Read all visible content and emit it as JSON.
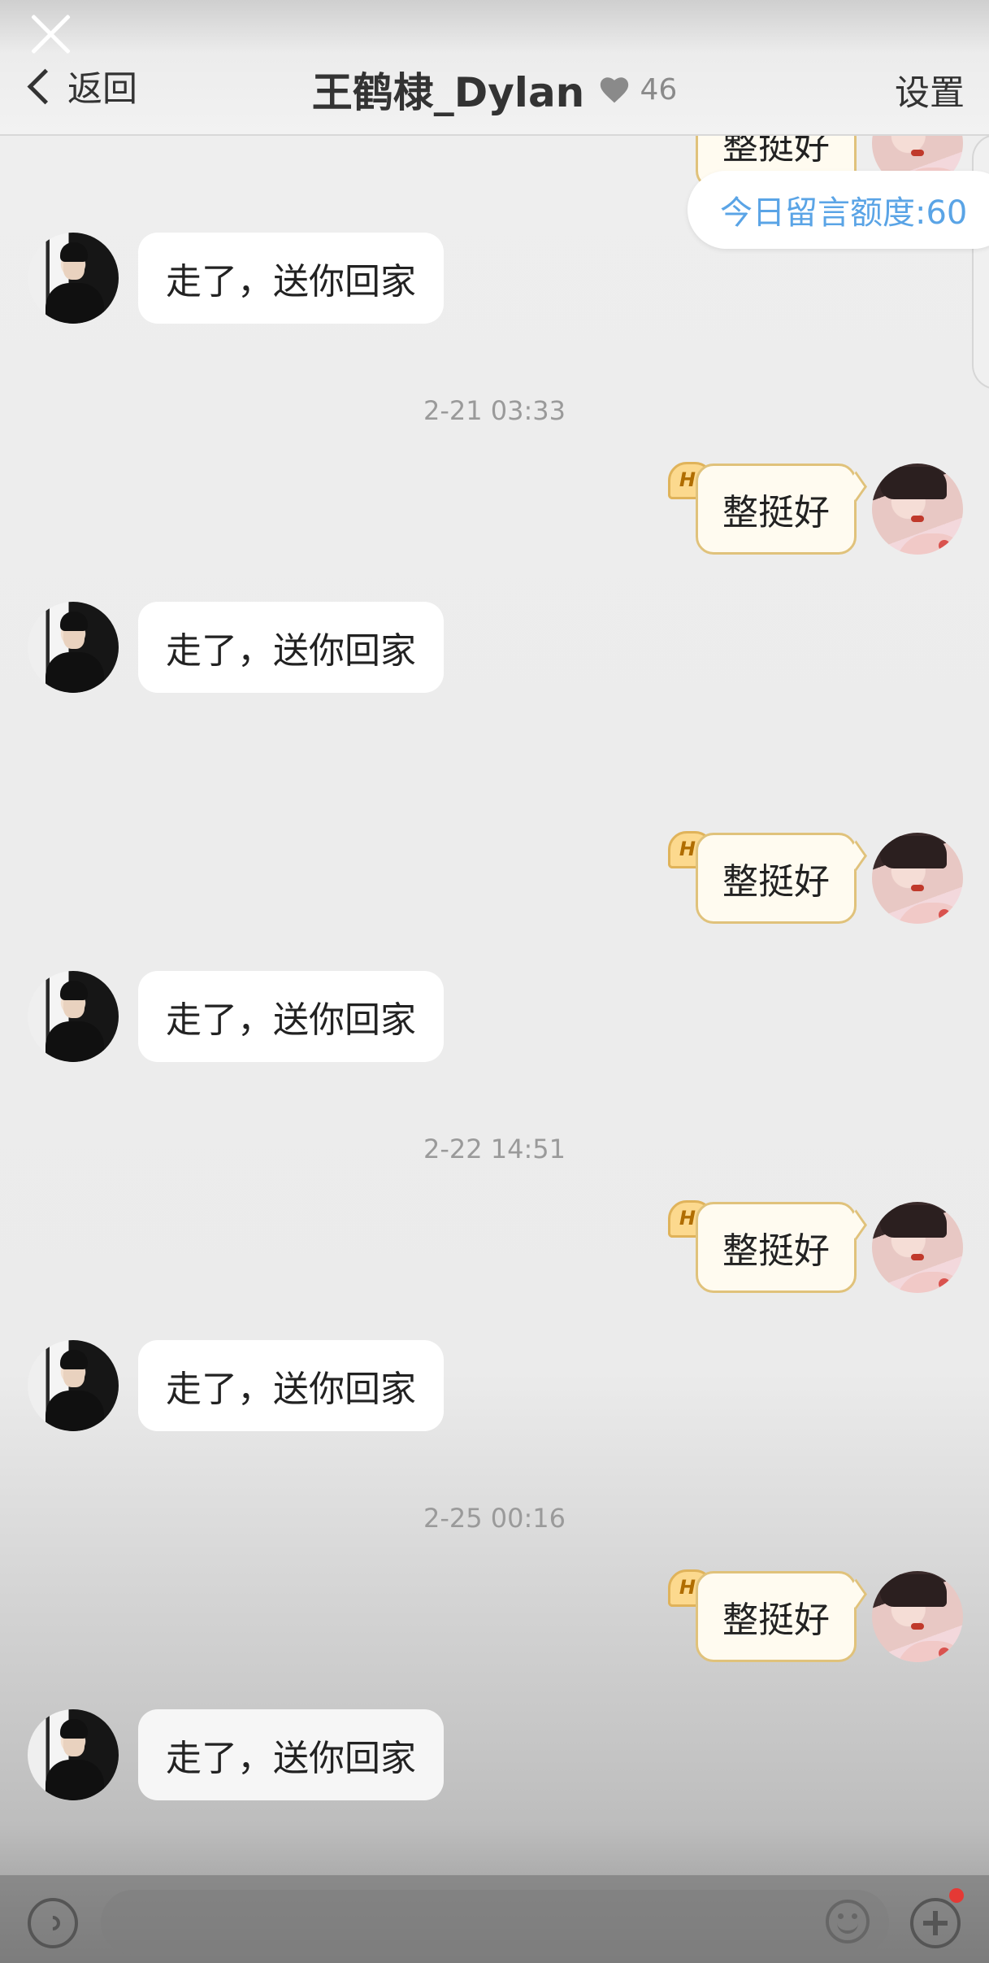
{
  "header": {
    "back_label": "返回",
    "title": "王鹤棣_Dylan",
    "heart_count": "46",
    "settings_label": "设置"
  },
  "quota": {
    "text": "今日留言额度:60"
  },
  "messages": {
    "in_text": "走了，送你回家",
    "out_text": "整挺好",
    "hi_label": "Hi"
  },
  "timestamps": [
    "2-21 03:33",
    "2-22 14:51",
    "2-25 00:16"
  ],
  "partial_top": {
    "text": "整挺好"
  },
  "colors": {
    "accent_blue": "#5aa4e6",
    "out_bubble_border": "#e0c27b",
    "notification_dot": "#e53935"
  },
  "icons": [
    "close-icon",
    "chevron-left-icon",
    "heart-icon",
    "voice-icon",
    "emoji-icon",
    "plus-icon"
  ]
}
